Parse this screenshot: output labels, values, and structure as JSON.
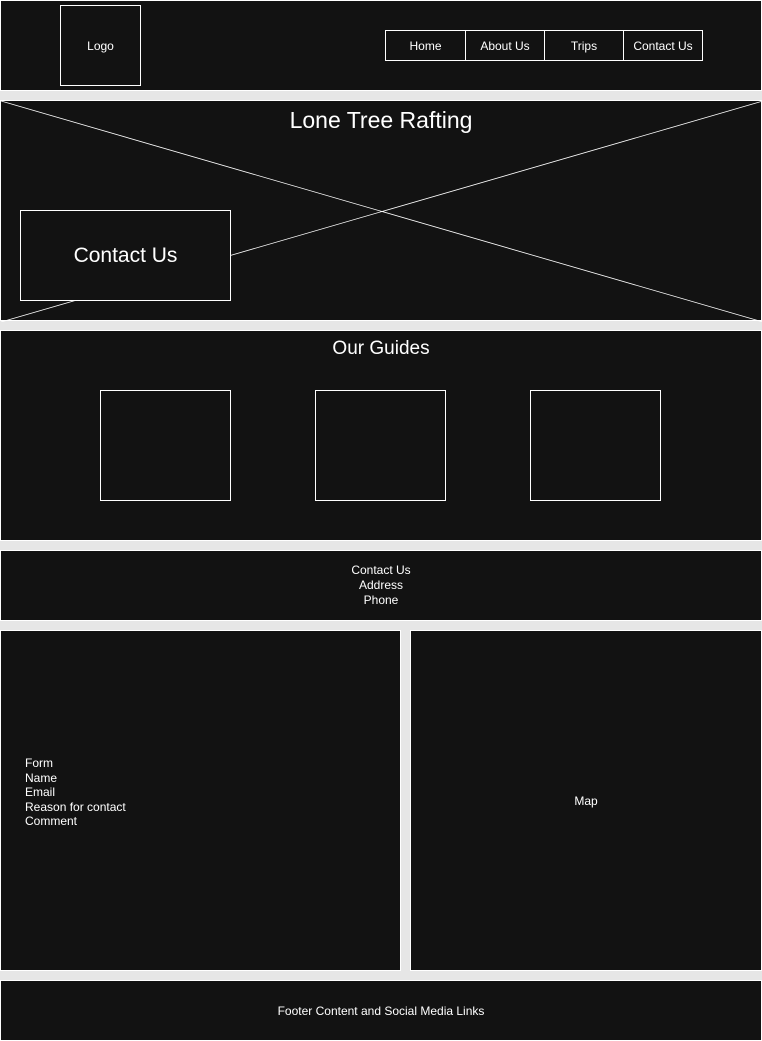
{
  "header": {
    "logo_label": "Logo",
    "nav": [
      "Home",
      "About Us",
      "Trips",
      "Contact Us"
    ]
  },
  "hero": {
    "title": "Lone Tree Rafting",
    "cta_label": "Contact Us"
  },
  "guides": {
    "title": "Our Guides"
  },
  "contact_info": {
    "lines": [
      "Contact Us",
      "Address",
      "Phone"
    ]
  },
  "form": {
    "lines": [
      "Form",
      "Name",
      "Email",
      "Reason for contact",
      "Comment"
    ]
  },
  "map": {
    "label": "Map"
  },
  "footer": {
    "text": "Footer Content and Social Media Links"
  },
  "colors": {
    "panel": "#121212",
    "background": "#e6e6e6",
    "stroke": "#ffffff"
  }
}
